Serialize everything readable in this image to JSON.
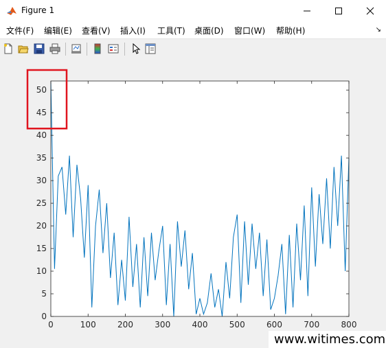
{
  "window": {
    "title": "Figure 1"
  },
  "menu": [
    "文件(F)",
    "编辑(E)",
    "查看(V)",
    "插入(I)",
    "工具(T)",
    "桌面(D)",
    "窗口(W)",
    "帮助(H)"
  ],
  "menu_overflow_icon": "chevron-right-small-icon",
  "toolbar": {
    "buttons": [
      "new-figure-icon",
      "open-file-icon",
      "save-icon",
      "print-icon",
      "link-plot-icon",
      "insert-colorbar-icon",
      "insert-legend-icon",
      "edit-plot-arrow-icon",
      "property-inspector-icon"
    ]
  },
  "colors": {
    "line": "#0072bd",
    "highlight": "#e0141e",
    "axes_bg": "#ffffff",
    "figure_bg": "#f0f0f0"
  },
  "chart_data": {
    "type": "line",
    "title": "",
    "xlabel": "",
    "ylabel": "",
    "xlim": [
      0,
      800
    ],
    "ylim": [
      0,
      52
    ],
    "xticks": [
      0,
      100,
      200,
      300,
      400,
      500,
      600,
      700,
      800
    ],
    "yticks": [
      0,
      5,
      10,
      15,
      20,
      25,
      30,
      35,
      40,
      45,
      50
    ],
    "grid": false,
    "series": [
      {
        "x": [
          0,
          10,
          20,
          30,
          40,
          50,
          60,
          70,
          80,
          90,
          100,
          110,
          120,
          130,
          140,
          150,
          160,
          170,
          180,
          190,
          200,
          210,
          220,
          230,
          240,
          250,
          260,
          270,
          280,
          290,
          300,
          310,
          320,
          330,
          340,
          350,
          360,
          370,
          380,
          390,
          400,
          410,
          420,
          430,
          440,
          450,
          460,
          470,
          480,
          490,
          500,
          510,
          520,
          530,
          540,
          550,
          560,
          570,
          580,
          590,
          600,
          610,
          620,
          630,
          640,
          650,
          660,
          670,
          680,
          690,
          700,
          710,
          720,
          730,
          740,
          750,
          760,
          770,
          780,
          790,
          800
        ],
        "y": [
          52,
          10.5,
          31,
          33,
          22.5,
          35.5,
          17.5,
          33.5,
          26,
          13,
          29,
          2,
          20,
          28,
          14,
          25,
          8.5,
          18.5,
          2.5,
          12.5,
          3.5,
          22,
          6.5,
          16,
          2,
          17.5,
          4.5,
          18.5,
          8,
          14.5,
          20,
          2.5,
          16,
          0,
          21,
          11,
          19,
          6,
          14,
          0.5,
          4,
          0.5,
          3,
          9.5,
          2,
          6,
          0,
          12,
          4,
          17.5,
          22.5,
          3,
          21,
          7,
          20.5,
          10.5,
          18.5,
          4.5,
          17,
          1.5,
          4,
          9,
          16,
          0.5,
          18,
          2,
          20.5,
          8,
          24.5,
          4.5,
          28.5,
          11,
          27,
          16,
          30.5,
          15,
          33,
          20,
          35.5,
          10,
          35
        ]
      }
    ],
    "annotation_box": "red rectangle around y ticks 45 and 50"
  },
  "watermark": "www.witimes.com"
}
